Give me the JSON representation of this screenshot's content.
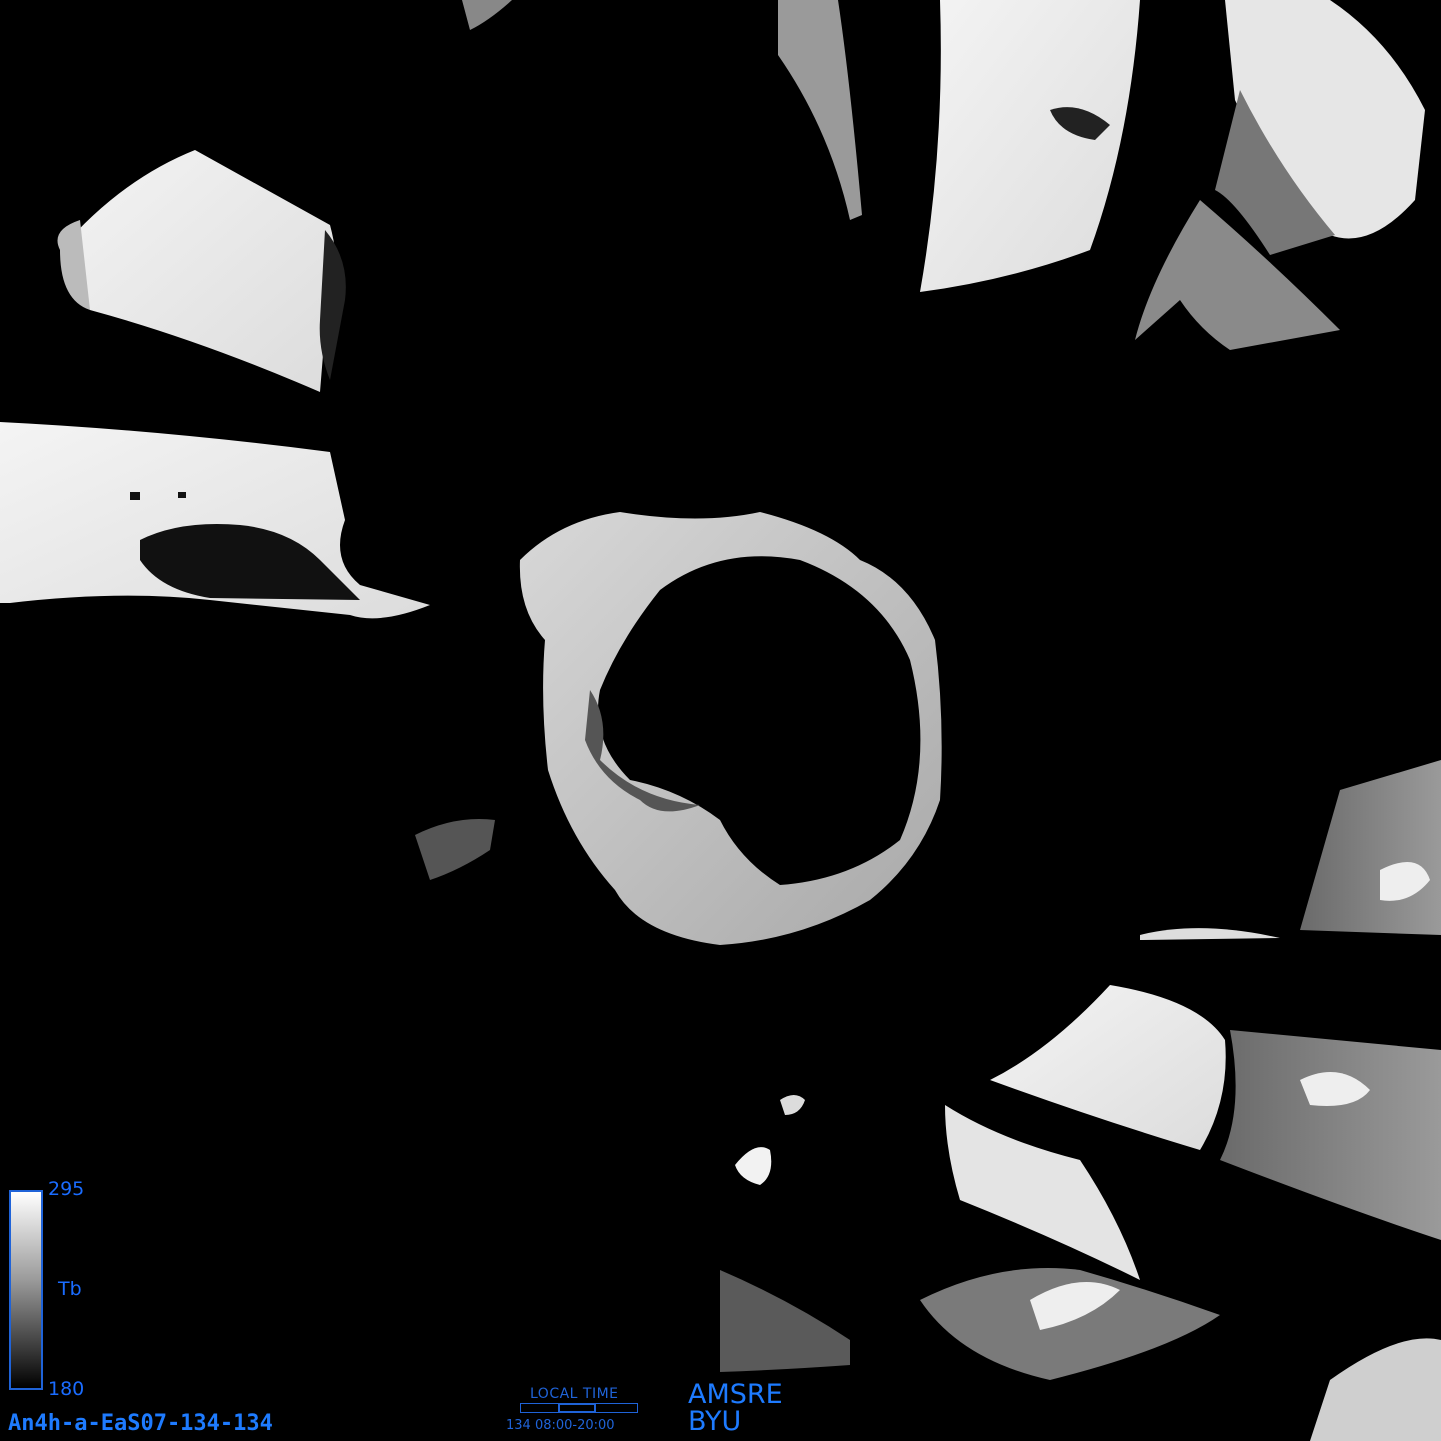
{
  "legend": {
    "max": "295",
    "min": "180",
    "label": "Tb",
    "bar_border_color": "#1f63d8",
    "gradient_top": "#ffffff",
    "gradient_bottom": "#000000"
  },
  "filename": "An4h-a-EaS07-134-134",
  "local_time": {
    "title": "LOCAL TIME",
    "value": "134 08:00-20:00"
  },
  "credits": {
    "sensor": "AMSRE",
    "org": "BYU"
  },
  "colors": {
    "background": "#000000",
    "label_blue": "#1e7bff"
  }
}
